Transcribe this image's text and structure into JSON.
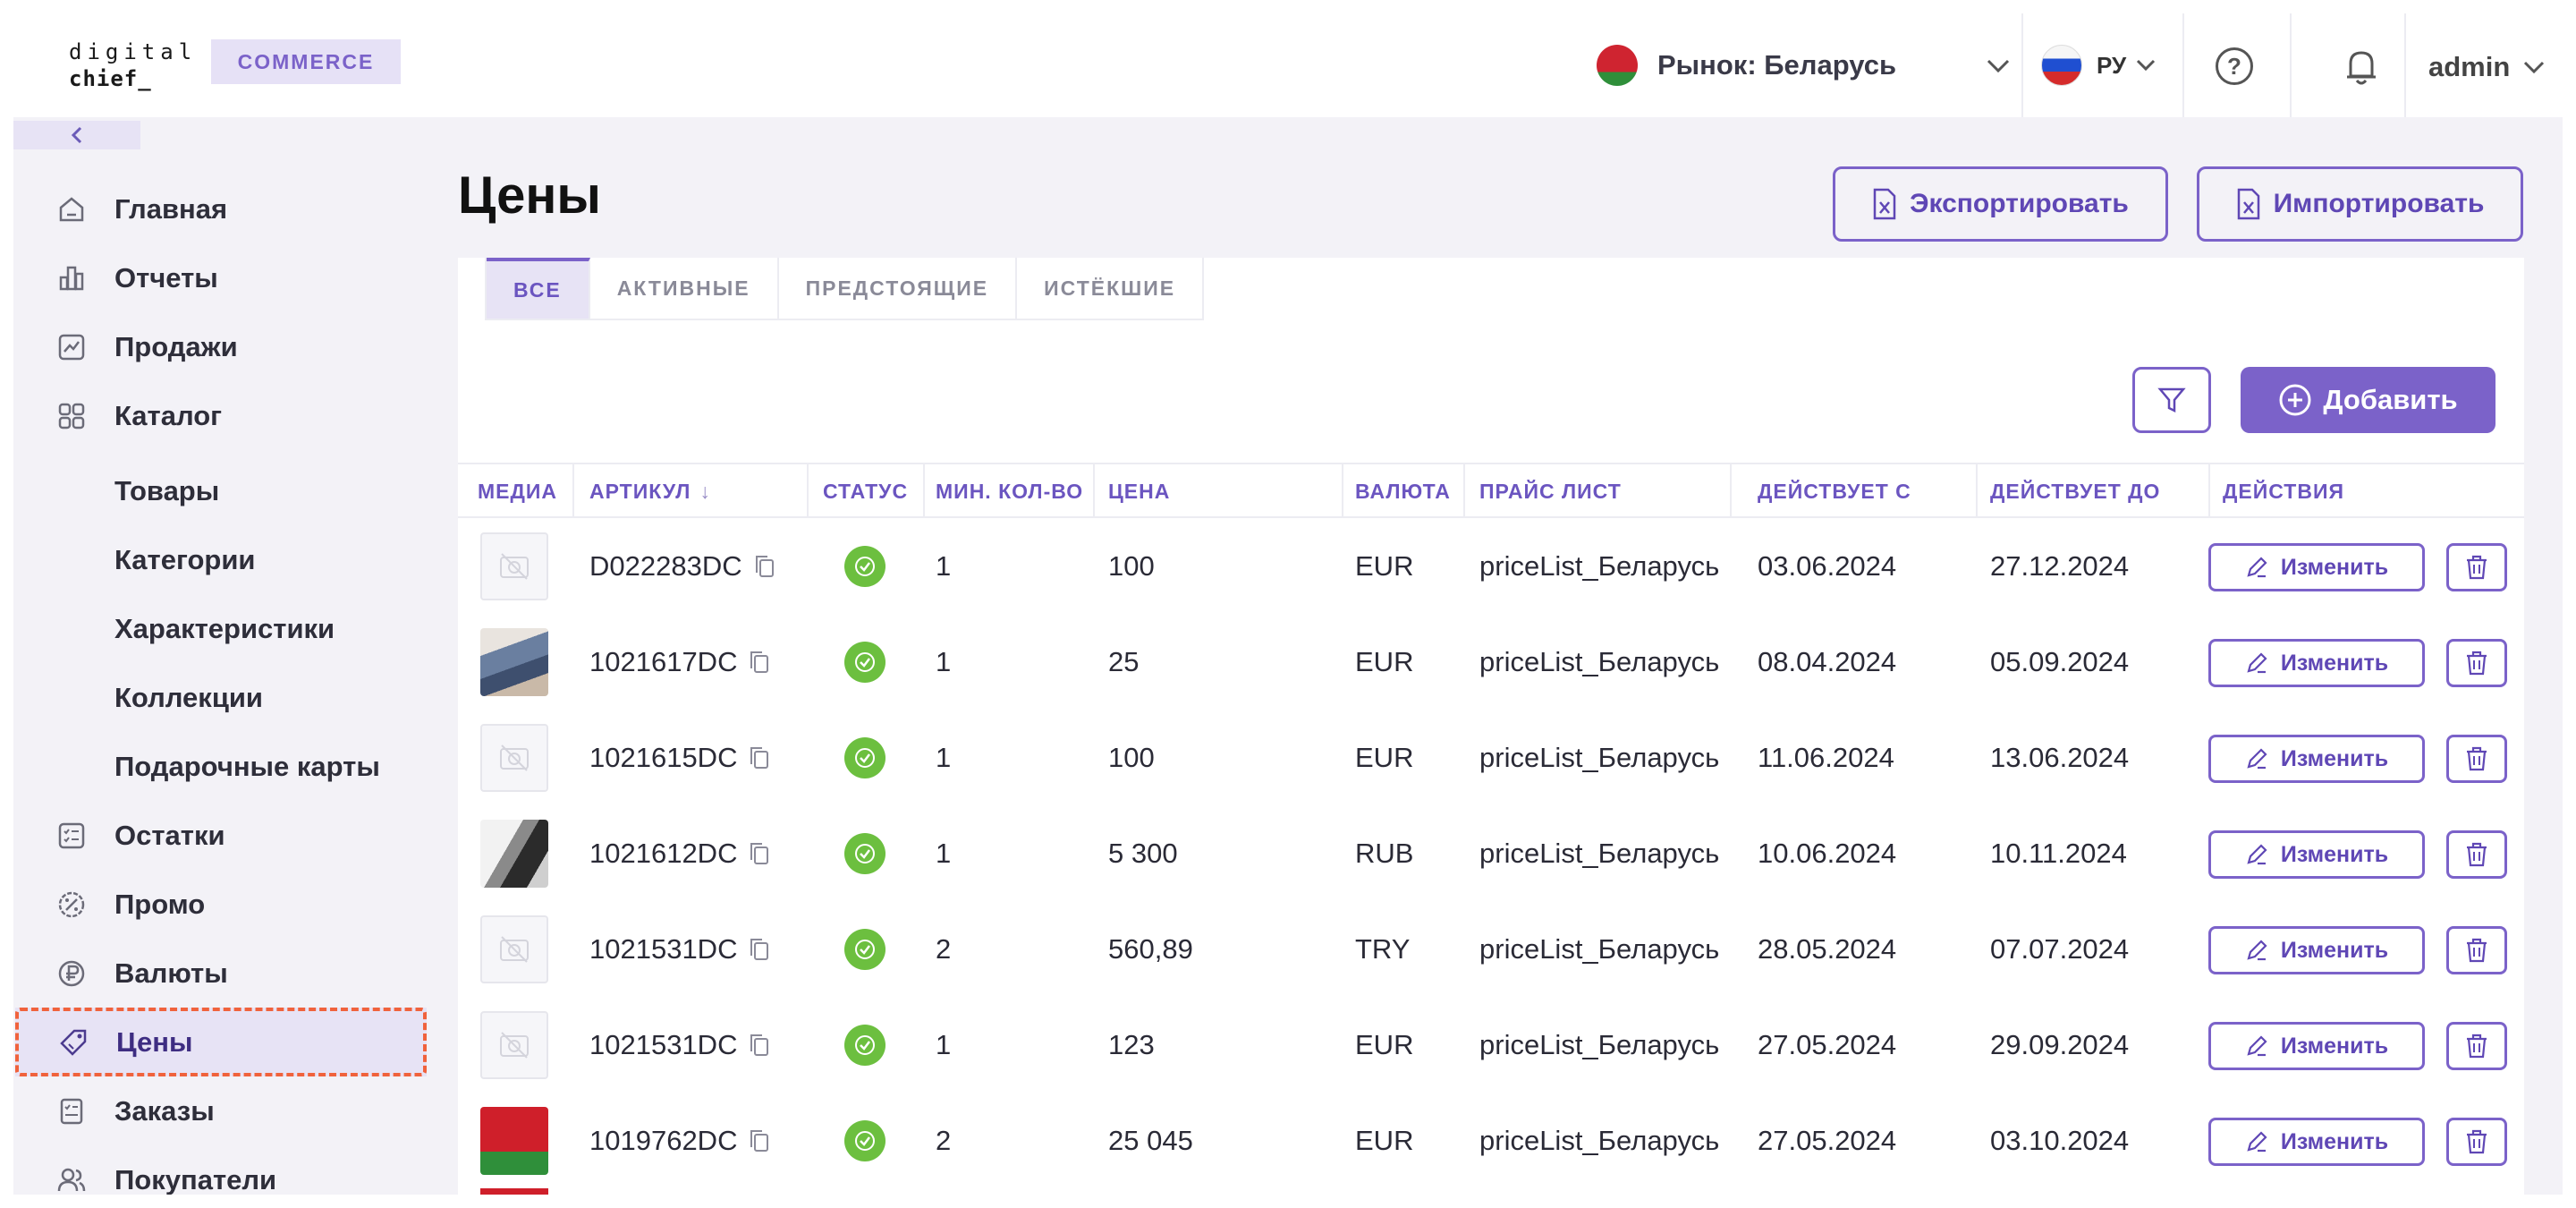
{
  "header": {
    "logo_line1": "digital",
    "logo_line2": "chief_",
    "badge": "COMMERCE",
    "market": "Рынок: Беларусь",
    "language": "РУ",
    "user": "admin"
  },
  "sidebar": {
    "items": [
      {
        "label": "Главная",
        "icon": "home-icon"
      },
      {
        "label": "Отчеты",
        "icon": "chart-icon"
      },
      {
        "label": "Продажи",
        "icon": "sales-icon"
      },
      {
        "label": "Каталог",
        "icon": "catalog-icon"
      },
      {
        "label": "Товары"
      },
      {
        "label": "Категории"
      },
      {
        "label": "Характеристики"
      },
      {
        "label": "Коллекции"
      },
      {
        "label": "Подарочные карты"
      },
      {
        "label": "Остатки",
        "icon": "stock-icon"
      },
      {
        "label": "Промо",
        "icon": "promo-icon"
      },
      {
        "label": "Валюты",
        "icon": "currency-icon"
      },
      {
        "label": "Цены",
        "icon": "price-tag-icon",
        "active": true
      },
      {
        "label": "Заказы",
        "icon": "orders-icon"
      },
      {
        "label": "Покупатели",
        "icon": "customers-icon"
      }
    ]
  },
  "page": {
    "title": "Цены",
    "export_label": "Экспортировать",
    "import_label": "Импортировать",
    "add_label": "Добавить"
  },
  "tabs": [
    "ВСЕ",
    "АКТИВНЫЕ",
    "ПРЕДСТОЯЩИЕ",
    "ИСТЁКШИЕ"
  ],
  "table": {
    "columns": [
      "МЕДИА",
      "АРТИКУЛ",
      "СТАТУС",
      "МИН. КОЛ-ВО",
      "ЦЕНА",
      "ВАЛЮТА",
      "ПРАЙС ЛИСТ",
      "ДЕЙСТВУЕТ С",
      "ДЕЙСТВУЕТ ДО",
      "ДЕЙСТВИЯ"
    ],
    "sort_indicator": "↓",
    "edit_label": "Изменить",
    "rows": [
      {
        "media": "placeholder",
        "sku": "D022283DC",
        "min_qty": "1",
        "price": "100",
        "currency": "EUR",
        "pricelist": "priceList_Беларусь",
        "from": "03.06.2024",
        "to": "27.12.2024"
      },
      {
        "media": "photo-clothes",
        "sku": "1021617DC",
        "min_qty": "1",
        "price": "25",
        "currency": "EUR",
        "pricelist": "priceList_Беларусь",
        "from": "08.04.2024",
        "to": "05.09.2024"
      },
      {
        "media": "placeholder",
        "sku": "1021615DC",
        "min_qty": "1",
        "price": "100",
        "currency": "EUR",
        "pricelist": "priceList_Беларусь",
        "from": "11.06.2024",
        "to": "13.06.2024"
      },
      {
        "media": "photo-phone",
        "sku": "1021612DC",
        "min_qty": "1",
        "price": "5 300",
        "currency": "RUB",
        "pricelist": "priceList_Беларусь",
        "from": "10.06.2024",
        "to": "10.11.2024"
      },
      {
        "media": "placeholder",
        "sku": "1021531DC",
        "min_qty": "2",
        "price": "560,89",
        "currency": "TRY",
        "pricelist": "priceList_Беларусь",
        "from": "28.05.2024",
        "to": "07.07.2024"
      },
      {
        "media": "placeholder",
        "sku": "1021531DC",
        "min_qty": "1",
        "price": "123",
        "currency": "EUR",
        "pricelist": "priceList_Беларусь",
        "from": "27.05.2024",
        "to": "29.09.2024"
      },
      {
        "media": "photo-flag-by",
        "sku": "1019762DC",
        "min_qty": "2",
        "price": "25 045",
        "currency": "EUR",
        "pricelist": "priceList_Беларусь",
        "from": "27.05.2024",
        "to": "03.10.2024"
      }
    ]
  },
  "colors": {
    "accent": "#7b62c9",
    "status_ok": "#6cbf3f",
    "highlight_dash": "#f0623c"
  }
}
